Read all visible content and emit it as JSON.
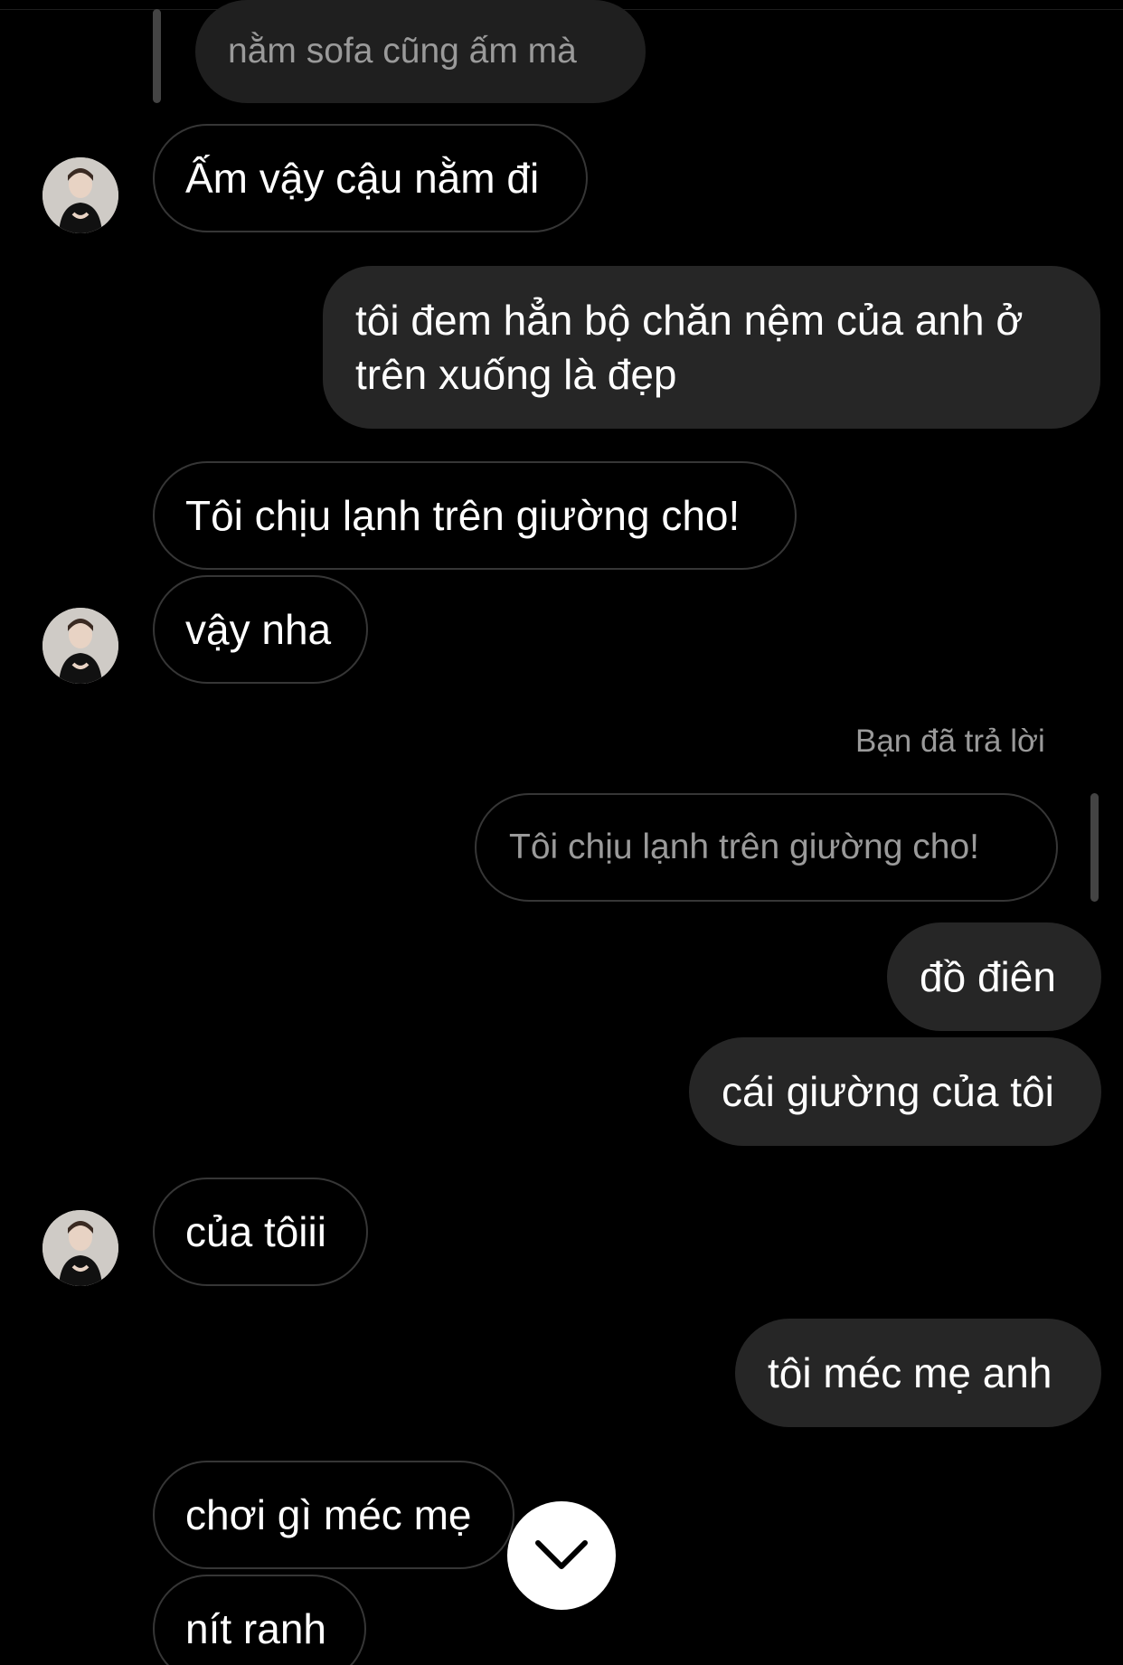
{
  "messages": [
    {
      "kind": "quoted",
      "text": "nằm sofa cũng ấm mà"
    },
    {
      "kind": "incoming",
      "text": "Ấm vậy cậu nằm đi"
    },
    {
      "kind": "outgoing",
      "text": "tôi đem hẳn bộ chăn nệm của anh ở trên xuống là đẹp"
    },
    {
      "kind": "incoming",
      "text": "Tôi chịu lạnh trên giường cho!"
    },
    {
      "kind": "incoming",
      "text": "vậy nha"
    },
    {
      "kind": "reply_label",
      "text": "Bạn đã trả lời"
    },
    {
      "kind": "quoted",
      "text": "Tôi chịu lạnh trên giường cho!"
    },
    {
      "kind": "outgoing",
      "text": "đồ điên"
    },
    {
      "kind": "outgoing",
      "text": "cái giường của tôi"
    },
    {
      "kind": "incoming",
      "text": "của tôiii"
    },
    {
      "kind": "outgoing",
      "text": "tôi méc mẹ anh"
    },
    {
      "kind": "incoming",
      "text": "chơi gì méc mẹ"
    },
    {
      "kind": "incoming",
      "text": "nít ranh"
    }
  ],
  "icons": {
    "scroll_down": "chevron-down-icon",
    "avatar": "contact-avatar"
  },
  "colors": {
    "background": "#000000",
    "outgoing_bubble": "#262626",
    "incoming_border": "#363636",
    "muted_text": "#9a9a9a"
  }
}
